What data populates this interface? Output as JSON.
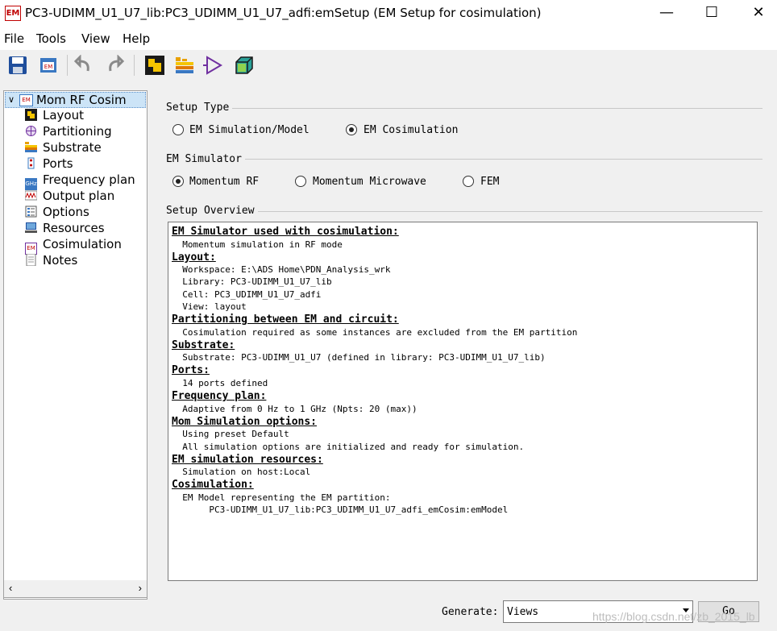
{
  "window": {
    "app_icon_text": "EM",
    "title": "PC3-UDIMM_U1_U7_lib:PC3_UDIMM_U1_U7_adfi:emSetup (EM Setup for cosimulation)",
    "minimize": "—",
    "maximize": "☐",
    "close": "✕"
  },
  "menu": [
    "File",
    "Tools",
    "View",
    "Help"
  ],
  "toolbar": {
    "icons": [
      "save-icon",
      "save-to-em-icon",
      "undo-icon",
      "redo-icon",
      "layout-icon",
      "substrate-icon",
      "port-icon",
      "3d-view-icon"
    ]
  },
  "tree": {
    "root": "Mom RF Cosim",
    "root_icon_text": "EM",
    "items": [
      {
        "label": "Layout",
        "icon": "layout-icon"
      },
      {
        "label": "Partitioning",
        "icon": "partitioning-icon"
      },
      {
        "label": "Substrate",
        "icon": "substrate-icon"
      },
      {
        "label": "Ports",
        "icon": "ports-icon"
      },
      {
        "label": "Frequency plan",
        "icon": "frequency-plan-icon",
        "icon_text": "GHz"
      },
      {
        "label": "Output plan",
        "icon": "output-plan-icon"
      },
      {
        "label": "Options",
        "icon": "options-icon"
      },
      {
        "label": "Resources",
        "icon": "resources-icon"
      },
      {
        "label": "Cosimulation",
        "icon": "cosimulation-icon",
        "icon_text": "EM"
      },
      {
        "label": "Notes",
        "icon": "notes-icon"
      }
    ]
  },
  "setup_type": {
    "label": "Setup Type",
    "options": [
      {
        "label": "EM Simulation/Model",
        "selected": false
      },
      {
        "label": "EM Cosimulation",
        "selected": true
      }
    ]
  },
  "em_simulator": {
    "label": "EM Simulator",
    "options": [
      {
        "label": "Momentum RF",
        "selected": true
      },
      {
        "label": "Momentum Microwave",
        "selected": false
      },
      {
        "label": "FEM",
        "selected": false
      }
    ]
  },
  "overview": {
    "label": "Setup Overview",
    "lines": [
      {
        "t": "h",
        "text": "EM Simulator used with cosimulation:"
      },
      {
        "t": "b",
        "text": "  Momentum simulation in RF mode"
      },
      {
        "t": "h",
        "text": "Layout:"
      },
      {
        "t": "b",
        "text": "  Workspace: E:\\ADS Home\\PDN_Analysis_wrk"
      },
      {
        "t": "b",
        "text": "  Library: PC3-UDIMM_U1_U7_lib"
      },
      {
        "t": "b",
        "text": "  Cell: PC3_UDIMM_U1_U7_adfi"
      },
      {
        "t": "b",
        "text": "  View: layout"
      },
      {
        "t": "h",
        "text": "Partitioning between EM and circuit:"
      },
      {
        "t": "b",
        "text": "  Cosimulation required as some instances are excluded from the EM partition"
      },
      {
        "t": "h",
        "text": "Substrate:"
      },
      {
        "t": "b",
        "text": "  Substrate: PC3-UDIMM_U1_U7 (defined in library: PC3-UDIMM_U1_U7_lib)"
      },
      {
        "t": "h",
        "text": "Ports:"
      },
      {
        "t": "b",
        "text": "  14 ports defined"
      },
      {
        "t": "h",
        "text": "Frequency plan:"
      },
      {
        "t": "b",
        "text": "  Adaptive from 0 Hz to 1 GHz (Npts: 20 (max))"
      },
      {
        "t": "h",
        "text": "Mom Simulation options:"
      },
      {
        "t": "b",
        "text": "  Using preset Default"
      },
      {
        "t": "b",
        "text": "  All simulation options are initialized and ready for simulation."
      },
      {
        "t": "h",
        "text": "EM simulation resources:"
      },
      {
        "t": "b",
        "text": "  Simulation on host:Local"
      },
      {
        "t": "h",
        "text": "Cosimulation:"
      },
      {
        "t": "b",
        "text": "  EM Model representing the EM partition:"
      },
      {
        "t": "b",
        "text": "       PC3-UDIMM_U1_U7_lib:PC3_UDIMM_U1_U7_adfi_emCosim:emModel"
      }
    ]
  },
  "footer": {
    "generate_label": "Generate:",
    "generate_value": "Views",
    "go_label": "Go",
    "watermark": "https://blog.csdn.net/zb_2015_lb"
  }
}
